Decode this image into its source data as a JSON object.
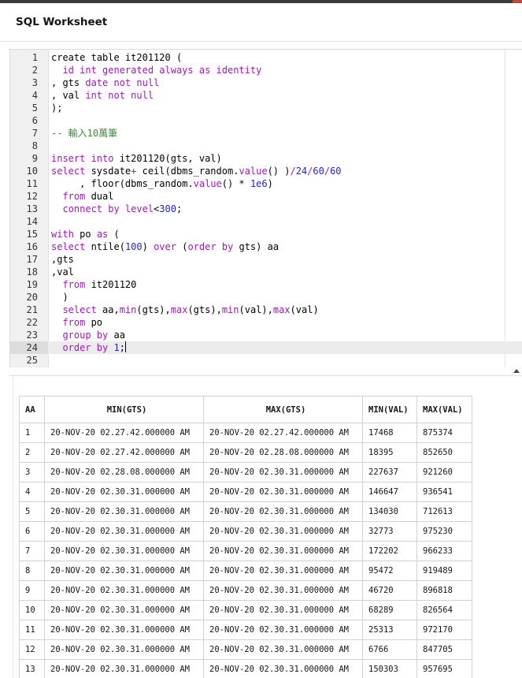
{
  "window": {
    "title": "SQL Worksheet"
  },
  "editor": {
    "active_line": 24,
    "lines": [
      [
        [
          "n",
          "create table "
        ],
        [
          "t",
          "it201120 ("
        ]
      ],
      [
        [
          "t",
          "  "
        ],
        [
          "k",
          "id int generated always as identity"
        ]
      ],
      [
        [
          "t",
          ", gts "
        ],
        [
          "k",
          "date not null"
        ]
      ],
      [
        [
          "t",
          ", val "
        ],
        [
          "k",
          "int not null"
        ]
      ],
      [
        [
          "t",
          ");"
        ]
      ],
      [],
      [
        [
          "c",
          "-- 輸入10萬筆"
        ]
      ],
      [],
      [
        [
          "k",
          "insert into "
        ],
        [
          "t",
          "it201120(gts, val)"
        ]
      ],
      [
        [
          "k",
          "select "
        ],
        [
          "t",
          "sysdate"
        ],
        [
          "k",
          "+ "
        ],
        [
          "t",
          "ceil(dbms_random."
        ],
        [
          "k",
          "value"
        ],
        [
          "t",
          "() )"
        ],
        [
          "k",
          "/"
        ],
        [
          "u",
          "24"
        ],
        [
          "k",
          "/"
        ],
        [
          "u",
          "60"
        ],
        [
          "k",
          "/"
        ],
        [
          "u",
          "60"
        ]
      ],
      [
        [
          "t",
          "     , floor(dbms_random."
        ],
        [
          "k",
          "value"
        ],
        [
          "t",
          "() * "
        ],
        [
          "u",
          "1e6"
        ],
        [
          "t",
          ")"
        ]
      ],
      [
        [
          "t",
          "  "
        ],
        [
          "k",
          "from "
        ],
        [
          "t",
          "dual"
        ]
      ],
      [
        [
          "t",
          "  "
        ],
        [
          "k",
          "connect by level"
        ],
        [
          "t",
          "<"
        ],
        [
          "u",
          "300"
        ],
        [
          "t",
          ";"
        ]
      ],
      [],
      [
        [
          "k",
          "with "
        ],
        [
          "t",
          "po "
        ],
        [
          "k",
          "as "
        ],
        [
          "t",
          "("
        ]
      ],
      [
        [
          "k",
          "select "
        ],
        [
          "t",
          "ntile("
        ],
        [
          "u",
          "100"
        ],
        [
          "t",
          ") "
        ],
        [
          "k",
          "over "
        ],
        [
          "t",
          "("
        ],
        [
          "k",
          "order by "
        ],
        [
          "t",
          "gts) aa"
        ]
      ],
      [
        [
          "t",
          ",gts"
        ]
      ],
      [
        [
          "t",
          ",val"
        ]
      ],
      [
        [
          "t",
          "  "
        ],
        [
          "k",
          "from "
        ],
        [
          "t",
          "it201120"
        ]
      ],
      [
        [
          "t",
          "  )"
        ]
      ],
      [
        [
          "t",
          "  "
        ],
        [
          "k",
          "select "
        ],
        [
          "t",
          "aa,"
        ],
        [
          "k",
          "min"
        ],
        [
          "t",
          "(gts),"
        ],
        [
          "k",
          "max"
        ],
        [
          "t",
          "(gts),"
        ],
        [
          "k",
          "min"
        ],
        [
          "t",
          "(val),"
        ],
        [
          "k",
          "max"
        ],
        [
          "t",
          "(val)"
        ]
      ],
      [
        [
          "t",
          "  "
        ],
        [
          "k",
          "from "
        ],
        [
          "t",
          "po"
        ]
      ],
      [
        [
          "t",
          "  "
        ],
        [
          "k",
          "group by "
        ],
        [
          "t",
          "aa"
        ]
      ],
      [
        [
          "t",
          "  "
        ],
        [
          "k",
          "order by "
        ],
        [
          "u",
          "1"
        ],
        [
          "t",
          ";"
        ],
        [
          "cursor",
          ""
        ]
      ],
      []
    ]
  },
  "results": {
    "columns": [
      "AA",
      "MIN(GTS)",
      "MAX(GTS)",
      "MIN(VAL)",
      "MAX(VAL)"
    ],
    "rows": [
      [
        "1",
        "20-NOV-20 02.27.42.000000 AM",
        "20-NOV-20 02.27.42.000000 AM",
        "17468",
        "875374"
      ],
      [
        "2",
        "20-NOV-20 02.27.42.000000 AM",
        "20-NOV-20 02.28.08.000000 AM",
        "18395",
        "852650"
      ],
      [
        "3",
        "20-NOV-20 02.28.08.000000 AM",
        "20-NOV-20 02.30.31.000000 AM",
        "227637",
        "921260"
      ],
      [
        "4",
        "20-NOV-20 02.30.31.000000 AM",
        "20-NOV-20 02.30.31.000000 AM",
        "146647",
        "936541"
      ],
      [
        "5",
        "20-NOV-20 02.30.31.000000 AM",
        "20-NOV-20 02.30.31.000000 AM",
        "134030",
        "712613"
      ],
      [
        "6",
        "20-NOV-20 02.30.31.000000 AM",
        "20-NOV-20 02.30.31.000000 AM",
        "32773",
        "975230"
      ],
      [
        "7",
        "20-NOV-20 02.30.31.000000 AM",
        "20-NOV-20 02.30.31.000000 AM",
        "172202",
        "966233"
      ],
      [
        "8",
        "20-NOV-20 02.30.31.000000 AM",
        "20-NOV-20 02.30.31.000000 AM",
        "95472",
        "919489"
      ],
      [
        "9",
        "20-NOV-20 02.30.31.000000 AM",
        "20-NOV-20 02.30.31.000000 AM",
        "46720",
        "896818"
      ],
      [
        "10",
        "20-NOV-20 02.30.31.000000 AM",
        "20-NOV-20 02.30.31.000000 AM",
        "68289",
        "826564"
      ],
      [
        "11",
        "20-NOV-20 02.30.31.000000 AM",
        "20-NOV-20 02.30.31.000000 AM",
        "25313",
        "972170"
      ],
      [
        "12",
        "20-NOV-20 02.30.31.000000 AM",
        "20-NOV-20 02.30.31.000000 AM",
        "6766",
        "847705"
      ],
      [
        "13",
        "20-NOV-20 02.30.31.000000 AM",
        "20-NOV-20 02.30.31.000000 AM",
        "150303",
        "957695"
      ]
    ]
  },
  "icons": {
    "splitter": "collapse-up-icon"
  },
  "colors": {
    "keyword": "#9b1bb5",
    "number": "#2424c8",
    "comment": "#3b8a3b",
    "accent": "#c74634"
  }
}
